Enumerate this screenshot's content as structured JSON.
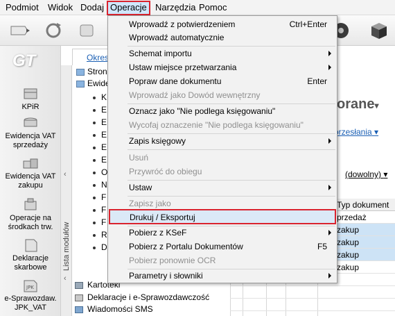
{
  "menubar": {
    "items": [
      "Podmiot",
      "Widok",
      "Dodaj",
      "Operacje",
      "Narzędzia",
      "Pomoc"
    ]
  },
  "modules": {
    "logo": "GT",
    "items": [
      "KPiR",
      "Ewidencja VAT sprzedaży",
      "Ewidencja VAT zakupu",
      "Operacje na środkach trw.",
      "Deklaracje skarbowe",
      "e-Sprawozdaw. JPK_VAT"
    ],
    "strip_label": "Lista modułów"
  },
  "tree": {
    "tab_label": "Okres",
    "top_items": [
      "Stron",
      "Ewide"
    ],
    "sub_items": [
      "K",
      "E",
      "E",
      "E",
      "E",
      "E",
      "O",
      "N",
      "F",
      "F",
      "F",
      "R",
      "D"
    ],
    "bottom_items": [
      "Kartoteki",
      "Deklaracje i e-Sprawozdawczość",
      "Wiadomości SMS"
    ]
  },
  "main": {
    "title": "orane",
    "link": "przesłania",
    "filter_label": ":",
    "filter_value": "(dowolny)",
    "grid_header": "Typ dokument",
    "grid_rows": [
      "przedaż",
      "zakup",
      "zakup",
      "zakup",
      "zakup"
    ]
  },
  "dropdown": {
    "items": [
      {
        "label": "Wprowadź z potwierdzeniem",
        "shortcut": "Ctrl+Enter",
        "submenu": false,
        "disabled": false
      },
      {
        "label": "Wprowadź automatycznie",
        "shortcut": "",
        "submenu": false,
        "disabled": false
      },
      {
        "label": "Schemat importu",
        "shortcut": "",
        "submenu": true,
        "disabled": false
      },
      {
        "label": "Ustaw miejsce przetwarzania",
        "shortcut": "",
        "submenu": true,
        "disabled": false
      },
      {
        "label": "Popraw dane dokumentu",
        "shortcut": "Enter",
        "submenu": false,
        "disabled": false
      },
      {
        "label": "Wprowadź jako Dowód wewnętrzny",
        "shortcut": "",
        "submenu": false,
        "disabled": true
      },
      {
        "label": "Oznacz jako \"Nie podlega księgowaniu\"",
        "shortcut": "",
        "submenu": false,
        "disabled": false
      },
      {
        "label": "Wycofaj oznaczenie \"Nie podlega księgowaniu\"",
        "shortcut": "",
        "submenu": false,
        "disabled": true
      },
      {
        "label": "Zapis księgowy",
        "shortcut": "",
        "submenu": true,
        "disabled": false
      },
      {
        "label": "Usuń",
        "shortcut": "",
        "submenu": false,
        "disabled": true
      },
      {
        "label": "Przywróć do obiegu",
        "shortcut": "",
        "submenu": false,
        "disabled": true
      },
      {
        "label": "Ustaw",
        "shortcut": "",
        "submenu": true,
        "disabled": false
      },
      {
        "label": "Zapisz jako",
        "shortcut": "",
        "submenu": false,
        "disabled": true
      },
      {
        "label": "Drukuj / Eksportuj",
        "shortcut": "",
        "submenu": false,
        "disabled": false
      },
      {
        "label": "Pobierz z KSeF",
        "shortcut": "",
        "submenu": true,
        "disabled": false
      },
      {
        "label": "Pobierz z Portalu Dokumentów",
        "shortcut": "F5",
        "submenu": false,
        "disabled": false
      },
      {
        "label": "Pobierz ponownie OCR",
        "shortcut": "",
        "submenu": false,
        "disabled": true
      },
      {
        "label": "Parametry i słowniki",
        "shortcut": "",
        "submenu": true,
        "disabled": false
      }
    ]
  }
}
